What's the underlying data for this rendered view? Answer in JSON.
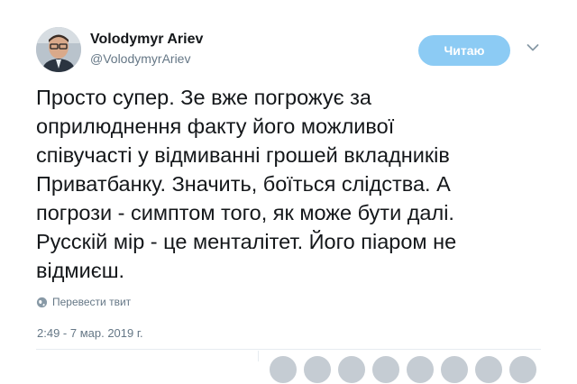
{
  "author": {
    "name": "Volodymyr Ariev",
    "handle": "@VolodymyrAriev"
  },
  "follow_button": {
    "label": "Читаю"
  },
  "tweet": {
    "text": "Просто супер. Зе вже погрожує за\nоприлюднення факту його можливої\nспівучасті у відмиванні грошей вкладників\nПриватбанку. Значить, боїться слідства. А\nпогрози - симптом того, як може бути далі.\nРусскій мір - це менталітет. Його піаром не\nвідмиєш.",
    "translate_label": "Перевести твит",
    "timestamp": "2:49 - 7 мар. 2019 г."
  },
  "icons": {
    "avatar": "profile-photo",
    "caret": "chevron-down-icon",
    "translate": "globe-icon"
  },
  "colors": {
    "follow_button_bg": "#8ccbf4",
    "secondary_text": "#657786",
    "primary_text": "#14171a"
  }
}
